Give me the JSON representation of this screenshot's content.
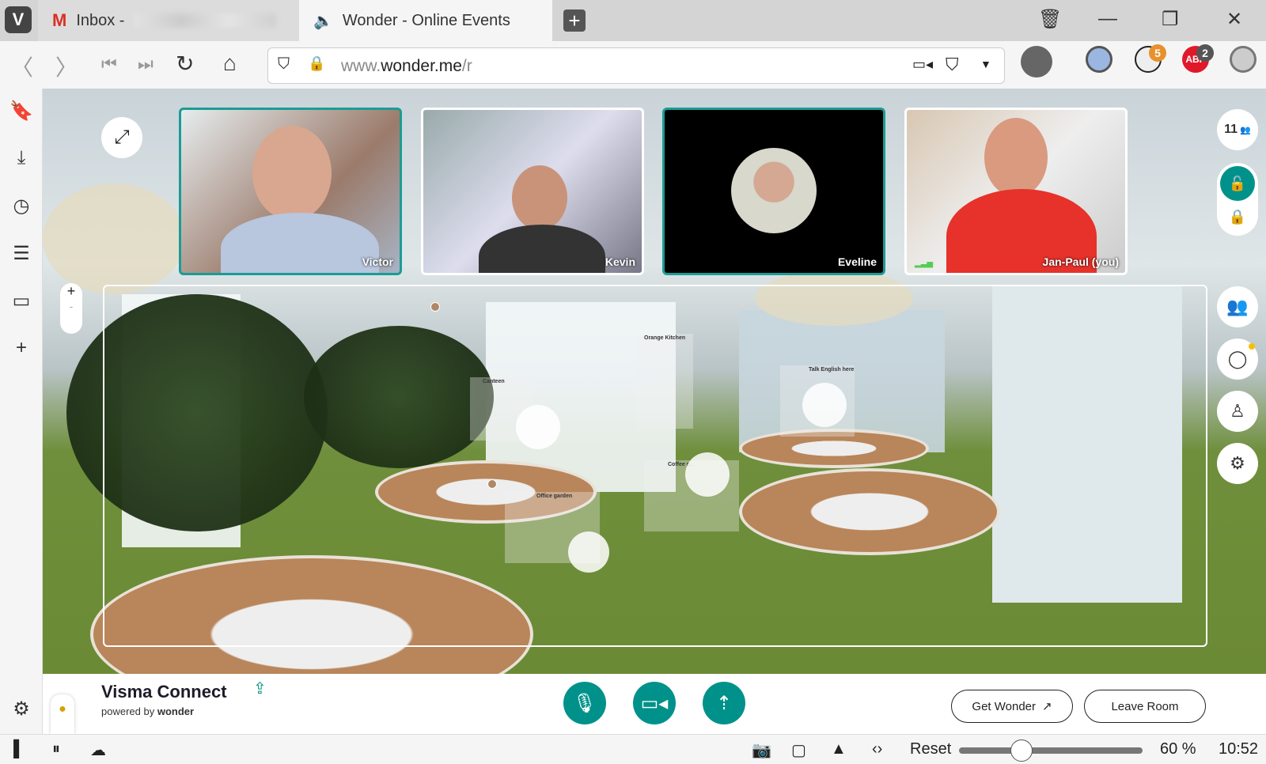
{
  "browser": {
    "tabs": [
      {
        "label": "Inbox - ",
        "icon": "gmail-icon"
      },
      {
        "label": "Wonder - Online Events",
        "icon": "speaker-icon"
      }
    ],
    "url_prefix": "www.",
    "url_domain": "wonder.me",
    "url_path": "/r",
    "extensions": [
      {
        "name": "lock-extension-icon"
      },
      {
        "name": "badger-icon",
        "badge": "5",
        "badge_color": "#e8912c"
      },
      {
        "name": "adblock-icon",
        "label": "ABP",
        "badge": "2",
        "badge_color": "#555"
      },
      {
        "name": "key-extension-icon"
      }
    ]
  },
  "room": {
    "participant_count": "11",
    "tiles": [
      {
        "name": "Victor",
        "active": true
      },
      {
        "name": "Kevin",
        "active": false
      },
      {
        "name": "Eveline",
        "active": true
      },
      {
        "name": "Jan-Paul (you)",
        "active": false
      }
    ],
    "zones": [
      "Canteen",
      "Orange Kitchen",
      "Talk English here",
      "Coffee p...",
      "Office garden"
    ],
    "zoom_in": "+",
    "zoom_out": "-"
  },
  "footer": {
    "title": "Visma Connect",
    "powered_by": "powered by",
    "brand": "wonder",
    "get_wonder": "Get Wonder",
    "leave_room": "Leave Room"
  },
  "statusbar": {
    "reset": "Reset",
    "zoom_value": 60,
    "zoom_label": "60 %",
    "time": "10:52"
  },
  "colors": {
    "accent": "#00928a"
  }
}
